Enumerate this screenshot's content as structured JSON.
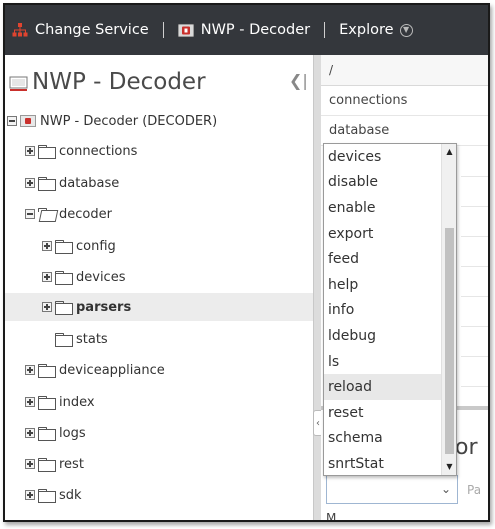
{
  "topbar": {
    "change_service": "Change Service",
    "service_name": "NWP - Decoder",
    "explore": "Explore"
  },
  "tree": {
    "title": "NWP - Decoder",
    "collapse_glyph": "❮|",
    "root": "NWP - Decoder (DECODER)",
    "items": [
      {
        "label": "connections"
      },
      {
        "label": "database"
      },
      {
        "label": "decoder"
      },
      {
        "label": "config"
      },
      {
        "label": "devices"
      },
      {
        "label": "parsers"
      },
      {
        "label": "stats"
      },
      {
        "label": "deviceappliance"
      },
      {
        "label": "index"
      },
      {
        "label": "logs"
      },
      {
        "label": "rest"
      },
      {
        "label": "sdk"
      }
    ],
    "selected": "parsers"
  },
  "right_panel": {
    "path": "/",
    "nodes": [
      "connections",
      "database"
    ],
    "message_heading_fragment": "or",
    "param_fragment": "Pa",
    "message_label_fragment": "M"
  },
  "dropdown": {
    "options": [
      "devices",
      "disable",
      "enable",
      "export",
      "feed",
      "help",
      "info",
      "ldebug",
      "ls",
      "reload",
      "reset",
      "schema",
      "snrtStat"
    ],
    "highlighted": "reload"
  },
  "colors": {
    "topbar_bg": "#34373c",
    "selection_bg": "#ececec",
    "decoder_badge": "#c9302c"
  }
}
